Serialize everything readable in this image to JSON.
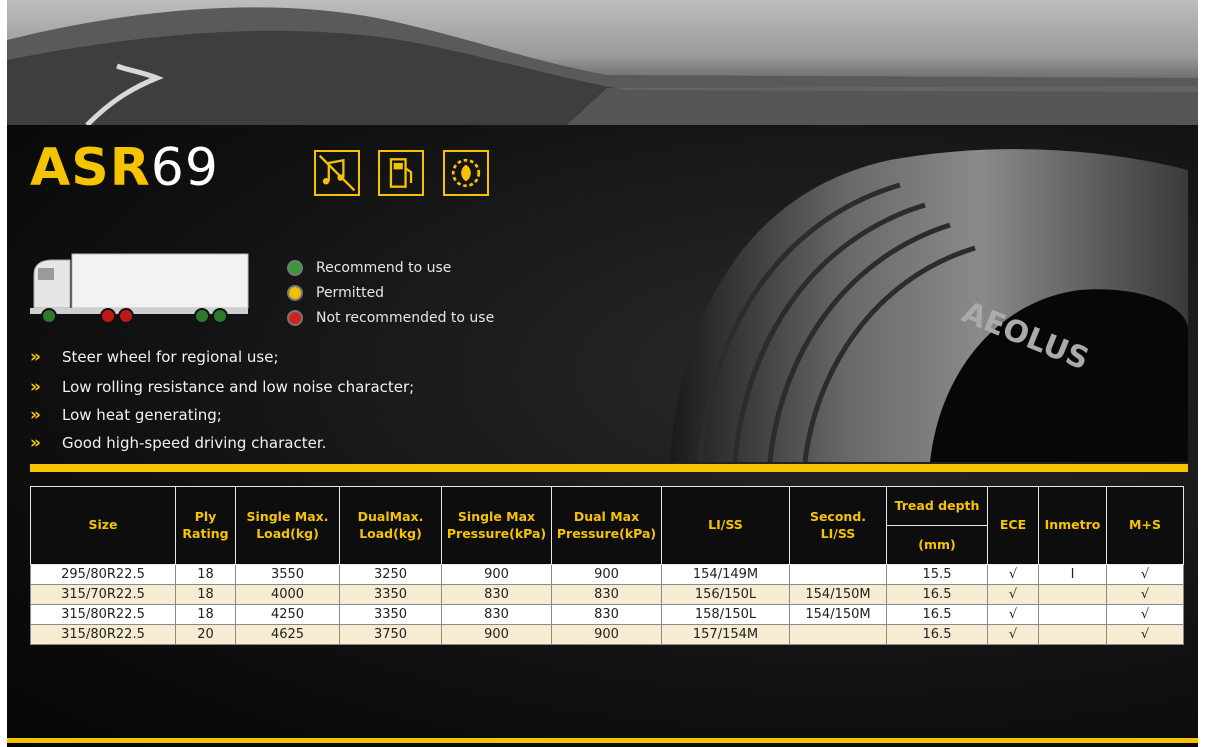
{
  "title": {
    "prefix": "ASR",
    "number": "69"
  },
  "icons": [
    "low-noise-icon",
    "fuel-saving-icon",
    "heat-generation-icon"
  ],
  "legend": [
    {
      "label": "Recommend to use",
      "color": "#3a9a3a"
    },
    {
      "label": "Permitted",
      "color": "#f0c000"
    },
    {
      "label": "Not recommended to use",
      "color": "#d02020"
    }
  ],
  "features": [
    "Steer wheel for regional use;",
    "Low rolling resistance and low noise character;",
    "Low heat generating;",
    "Good high-speed driving character."
  ],
  "tire_brand": "AEOLUS",
  "table": {
    "headers": {
      "size": "Size",
      "ply_1": "Ply",
      "ply_2": "Rating",
      "single_load_1": "Single Max.",
      "single_load_2": "Load(kg)",
      "dual_load_1": "DualMax.",
      "dual_load_2": "Load(kg)",
      "single_pressure_1": "Single Max",
      "single_pressure_2": "Pressure(kPa)",
      "dual_pressure_1": "Dual Max",
      "dual_pressure_2": "Pressure(kPa)",
      "liss": "LI/SS",
      "second_1": "Second.",
      "second_2": "LI/SS",
      "tread_1": "Tread  depth",
      "tread_2": "(mm)",
      "ece": "ECE",
      "inmetro": "Inmetro",
      "ms": "M+S"
    },
    "rows": [
      [
        "295/80R22.5",
        "18",
        "3550",
        "3250",
        "900",
        "900",
        "154/149M",
        "",
        "15.5",
        "√",
        "I",
        "√"
      ],
      [
        "315/70R22.5",
        "18",
        "4000",
        "3350",
        "830",
        "830",
        "156/150L",
        "154/150M",
        "16.5",
        "√",
        "",
        "√"
      ],
      [
        "315/80R22.5",
        "18",
        "4250",
        "3350",
        "830",
        "830",
        "158/150L",
        "154/150M",
        "16.5",
        "√",
        "",
        "√"
      ],
      [
        "315/80R22.5",
        "20",
        "4625",
        "3750",
        "900",
        "900",
        "157/154M",
        "",
        "16.5",
        "√",
        "",
        "√"
      ]
    ]
  }
}
